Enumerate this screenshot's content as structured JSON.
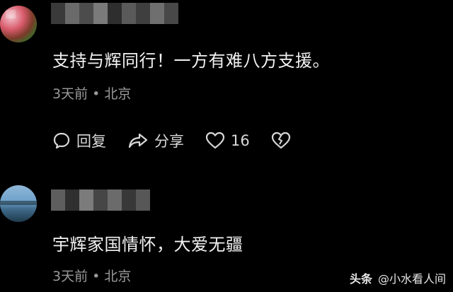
{
  "comments": [
    {
      "text": "支持与辉同行！一方有难八方支援。",
      "time": "3天前",
      "separator": "•",
      "location": "北京",
      "actions": {
        "reply_label": "回复",
        "share_label": "分享",
        "like_count": "16"
      }
    },
    {
      "text": "宇辉家国情怀，大爱无疆",
      "time": "3天前",
      "separator": "•",
      "location": "北京"
    }
  ],
  "watermark": {
    "brand": "头条",
    "handle": "@小水看人间"
  },
  "colors": {
    "background": "#000000",
    "text": "#f2f2f2",
    "meta": "#9a9a9a"
  },
  "icons": [
    "reply-icon",
    "share-icon",
    "heart-icon",
    "broken-heart-icon"
  ]
}
